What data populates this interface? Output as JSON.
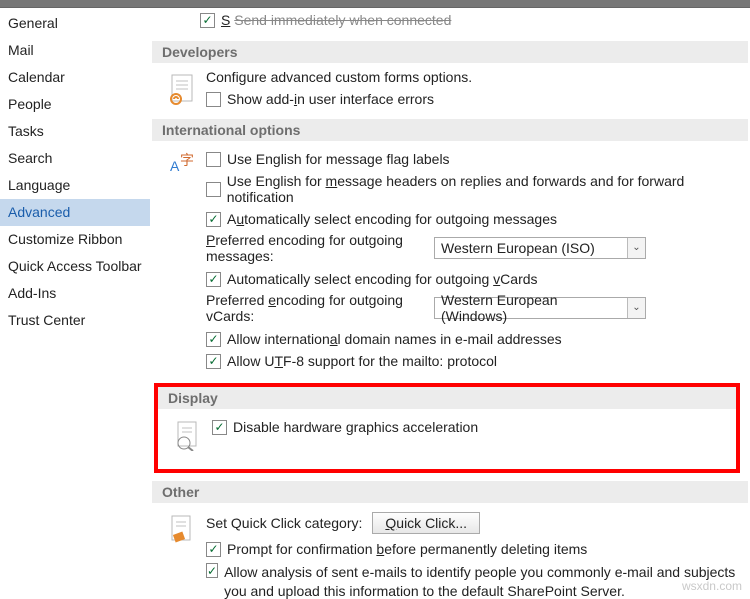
{
  "sidebar": {
    "items": [
      {
        "label": "General"
      },
      {
        "label": "Mail"
      },
      {
        "label": "Calendar"
      },
      {
        "label": "People"
      },
      {
        "label": "Tasks"
      },
      {
        "label": "Search"
      },
      {
        "label": "Language"
      },
      {
        "label": "Advanced",
        "selected": true
      },
      {
        "label": "Customize Ribbon"
      },
      {
        "label": "Quick Access Toolbar"
      },
      {
        "label": "Add-Ins"
      },
      {
        "label": "Trust Center"
      }
    ]
  },
  "sections": {
    "top_partial_label": "Send immediately when connected",
    "developers": {
      "title": "Developers",
      "desc": "Configure advanced custom forms options.",
      "show_addin": "Show add-in user interface errors"
    },
    "international": {
      "title": "International options",
      "english_flag": "Use English for message flag labels",
      "english_headers": "Use English for message headers on replies and forwards and for forward notification",
      "auto_outgoing": "Automatically select encoding for outgoing messages",
      "pref_outgoing_lbl": "Preferred encoding for outgoing messages:",
      "pref_outgoing_val": "Western European (ISO)",
      "auto_vcards": "Automatically select encoding for outgoing vCards",
      "pref_vcards_lbl": "Preferred encoding for outgoing vCards:",
      "pref_vcards_val": "Western European (Windows)",
      "intl_domain": "Allow international domain names in e-mail addresses",
      "utf8_mailto": "Allow UTF-8 support for the mailto: protocol"
    },
    "display": {
      "title": "Display",
      "disable_hw": "Disable hardware graphics acceleration"
    },
    "other": {
      "title": "Other",
      "quick_click_lbl": "Set Quick Click category:",
      "quick_click_btn": "Quick Click...",
      "prompt_delete": "Prompt for confirmation before permanently deleting items",
      "allow_analysis": "Allow analysis of sent e-mails to identify people you commonly e-mail and subjects you and upload this information to the default SharePoint Server."
    }
  },
  "watermark": "wsxdn.com"
}
